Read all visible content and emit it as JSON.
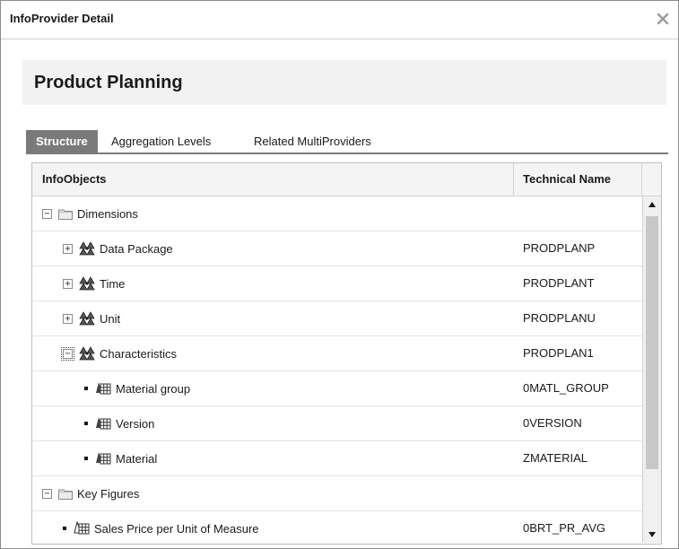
{
  "dialog": {
    "title": "InfoProvider Detail",
    "close_icon": "close-icon",
    "heading": "Product Planning"
  },
  "tabs": [
    {
      "label": "Structure",
      "active": true
    },
    {
      "label": "Aggregation Levels",
      "active": false
    },
    {
      "label": "Related MultiProviders",
      "active": false
    }
  ],
  "grid": {
    "columns": [
      "InfoObjects",
      "Technical Name"
    ],
    "rows": [
      {
        "name": "Dimensions",
        "technical": "",
        "level": 0,
        "toggle": "minus",
        "icon": "folder-icon"
      },
      {
        "name": "Data Package",
        "technical": "PRODPLANP",
        "level": 1,
        "toggle": "plus",
        "icon": "dimension-icon"
      },
      {
        "name": "Time",
        "technical": "PRODPLANT",
        "level": 1,
        "toggle": "plus",
        "icon": "dimension-icon"
      },
      {
        "name": "Unit",
        "technical": "PRODPLANU",
        "level": 1,
        "toggle": "plus",
        "icon": "dimension-icon"
      },
      {
        "name": "Characteristics",
        "technical": "PRODPLAN1",
        "level": 1,
        "toggle": "minus-focused",
        "icon": "dimension-icon"
      },
      {
        "name": "Material group",
        "technical": "0MATL_GROUP",
        "level": 2,
        "toggle": "bullet",
        "icon": "characteristic-icon"
      },
      {
        "name": "Version",
        "technical": "0VERSION",
        "level": 2,
        "toggle": "bullet",
        "icon": "characteristic-icon"
      },
      {
        "name": "Material",
        "technical": "ZMATERIAL",
        "level": 2,
        "toggle": "bullet",
        "icon": "characteristic-icon"
      },
      {
        "name": "Key Figures",
        "technical": "",
        "level": 0,
        "toggle": "minus",
        "icon": "folder-icon"
      },
      {
        "name": "Sales Price per Unit of Measure",
        "technical": "0BRT_PR_AVG",
        "level": 1,
        "toggle": "bullet",
        "icon": "key-figure-icon"
      }
    ]
  },
  "colors": {
    "tab_active_bg": "#7a7a7a",
    "header_panel_bg": "#f2f2f2",
    "border": "#bdbdbd"
  }
}
